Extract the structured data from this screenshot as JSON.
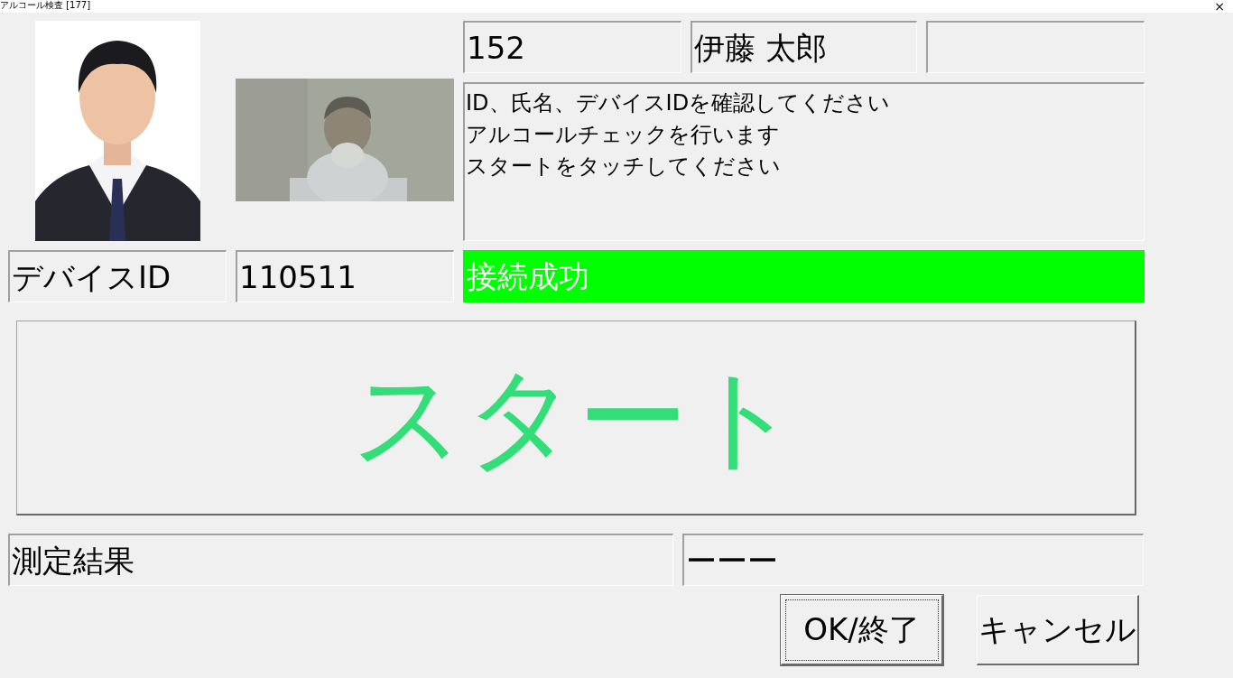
{
  "window": {
    "title": "アルコール検査 [177]",
    "close": "×"
  },
  "employee": {
    "id": "152",
    "name": "伊藤 太郎"
  },
  "message": [
    "ID、氏名、デバイスIDを確認してください",
    "アルコールチェックを行います",
    "スタートをタッチしてください"
  ],
  "device": {
    "label": "デバイスID",
    "value": "110511"
  },
  "status": {
    "text": "接続成功",
    "color": "#00ff00"
  },
  "start_button": {
    "label": "スタート"
  },
  "result": {
    "label": "測定結果",
    "value": "ーーー"
  },
  "buttons": [
    {
      "label": "OK/終了",
      "focused": true
    },
    {
      "label": "キャンセル",
      "focused": false
    }
  ]
}
